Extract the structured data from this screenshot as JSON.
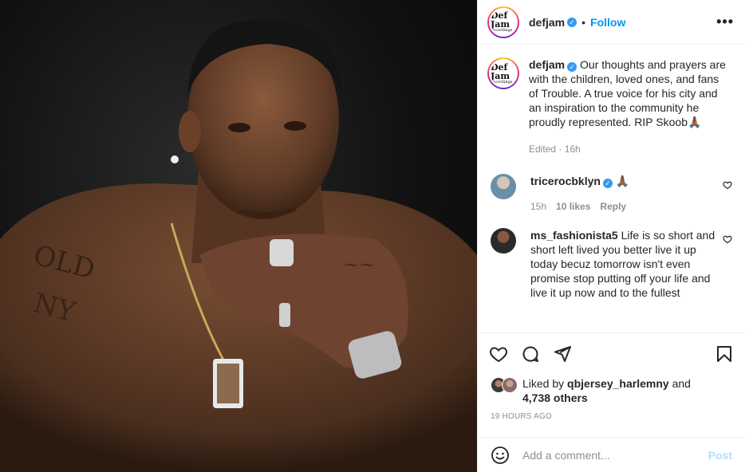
{
  "post": {
    "username": "defjam",
    "follow_label": "Follow",
    "dot": "•",
    "more_label": "•••",
    "logo_text": "Def Jam",
    "logo_sub": "recordings"
  },
  "caption": {
    "username": "defjam",
    "text": "Our thoughts and prayers are with the children, loved ones, and fans of Trouble. A true voice for his city and an inspiration to the community he proudly represented. RIP Skoob🙏🏾",
    "edited": "Edited · 16h"
  },
  "comments": [
    {
      "username": "tricerocbklyn",
      "text": "🙏🏾",
      "time": "15h",
      "likes": "10 likes",
      "reply": "Reply"
    },
    {
      "username": "ms_fashionista5",
      "text": "Life is so short and short left lived you better live it up today becuz tomorrow isn't even promise stop putting off your life and live it up now and to the fullest"
    }
  ],
  "liked_by": {
    "prefix": "Liked by",
    "user": "qbjersey_harlemny",
    "and": "and",
    "others": "4,738 others"
  },
  "timestamp": "19 HOURS AGO",
  "add_comment": {
    "placeholder": "Add a comment...",
    "post_label": "Post"
  },
  "icons": {
    "verified": "verified-badge-icon",
    "like": "heart-icon",
    "comment": "comment-bubble-icon",
    "share": "paper-plane-icon",
    "save": "bookmark-icon",
    "emoji": "smiley-icon"
  },
  "colors": {
    "link_blue": "#0095f6",
    "verified_blue": "#3897f0",
    "post_disabled": "#b2dffc",
    "meta_gray": "#8e8e8e"
  }
}
